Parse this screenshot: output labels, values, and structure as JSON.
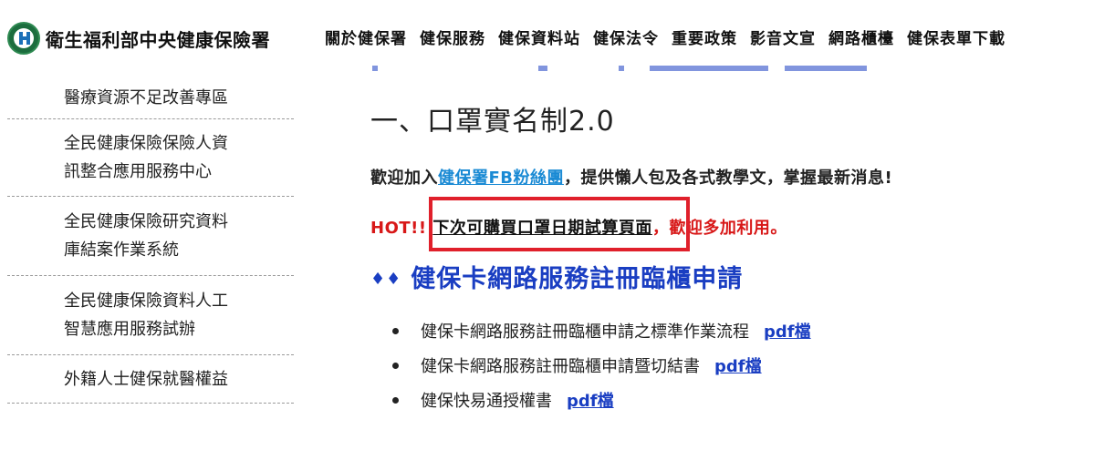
{
  "header": {
    "site_title": "衛生福利部中央健康保險署",
    "nav": [
      "關於健保署",
      "健保服務",
      "健保資料站",
      "健保法令",
      "重要政策",
      "影音文宣",
      "網路櫃檯",
      "健保表單下載"
    ]
  },
  "sidebar": {
    "items": [
      {
        "lines": [
          "醫療資源不足改善專區"
        ]
      },
      {
        "lines": [
          "全民健康保險保險人資",
          "訊整合應用服務中心"
        ]
      },
      {
        "lines": [
          "全民健康保險研究資料",
          "庫結案作業系統"
        ]
      },
      {
        "lines": [
          "全民健康保險資料人工",
          "智慧應用服務試辦"
        ]
      },
      {
        "lines": [
          "外籍人士健保就醫權益"
        ]
      }
    ]
  },
  "main": {
    "heading1": "一、口罩實名制2.0",
    "welcome": {
      "prefix": "歡迎加入",
      "link": "健保署FB粉絲團",
      "suffix": "，提供懶人包及各式教學文，掌握最新消息!"
    },
    "hot": {
      "label": "HOT!!",
      "link": "下次可購買口罩日期試算頁面",
      "suffix": "，歡迎多加利用。"
    },
    "heading2": {
      "marker": "♦♦",
      "text": "健保卡網路服務註冊臨櫃申請"
    },
    "list": [
      {
        "text": "健保卡網路服務註冊臨櫃申請之標準作業流程",
        "link": "pdf檔"
      },
      {
        "text": "健保卡網路服務註冊臨櫃申請暨切結書",
        "link": "pdf檔"
      },
      {
        "text": "健保快易通授權書",
        "link": "pdf檔"
      }
    ]
  },
  "colors": {
    "link_blue": "#1a3ec2",
    "fb_link": "#1a8ad4",
    "hot_red": "#d81818",
    "highlight_box": "#e0202b"
  }
}
